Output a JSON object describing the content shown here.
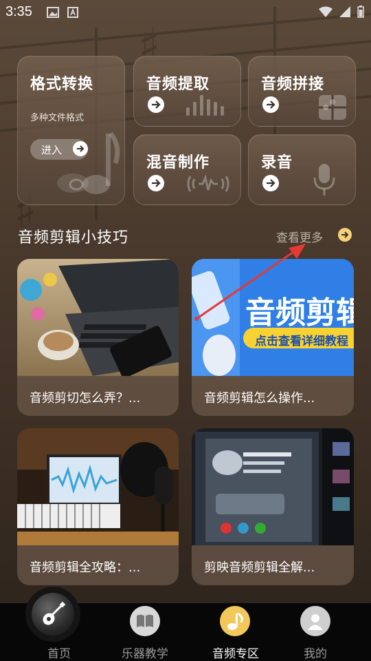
{
  "status_bar": {
    "time": "3:35"
  },
  "features": {
    "format_convert": {
      "title": "格式转换",
      "subtitle": "多种文件格式",
      "enter_label": "进入"
    },
    "audio_extract": {
      "title": "音频提取"
    },
    "audio_merge": {
      "title": "音频拼接"
    },
    "mix": {
      "title": "混音制作"
    },
    "record": {
      "title": "录音"
    }
  },
  "section": {
    "title": "音频剪辑小技巧",
    "more_label": "查看更多"
  },
  "tips": [
    {
      "caption": "音频剪切怎么弄？..."
    },
    {
      "caption": "音频剪辑怎么操作...",
      "banner_title": "音频剪辑",
      "banner_sub": "点击查看详细教程"
    },
    {
      "caption": "音频剪辑全攻略：..."
    },
    {
      "caption": "剪映音频剪辑全解..."
    }
  ],
  "tabbar": {
    "items": [
      {
        "label": "首页"
      },
      {
        "label": "乐器教学"
      },
      {
        "label": "音频专区"
      },
      {
        "label": "我的"
      }
    ]
  },
  "colors": {
    "accent_yellow": "#f3d27a",
    "tab_active": "#ffffff",
    "tab_inactive": "#9b9b9b",
    "tabbar_bg": "#070707"
  }
}
